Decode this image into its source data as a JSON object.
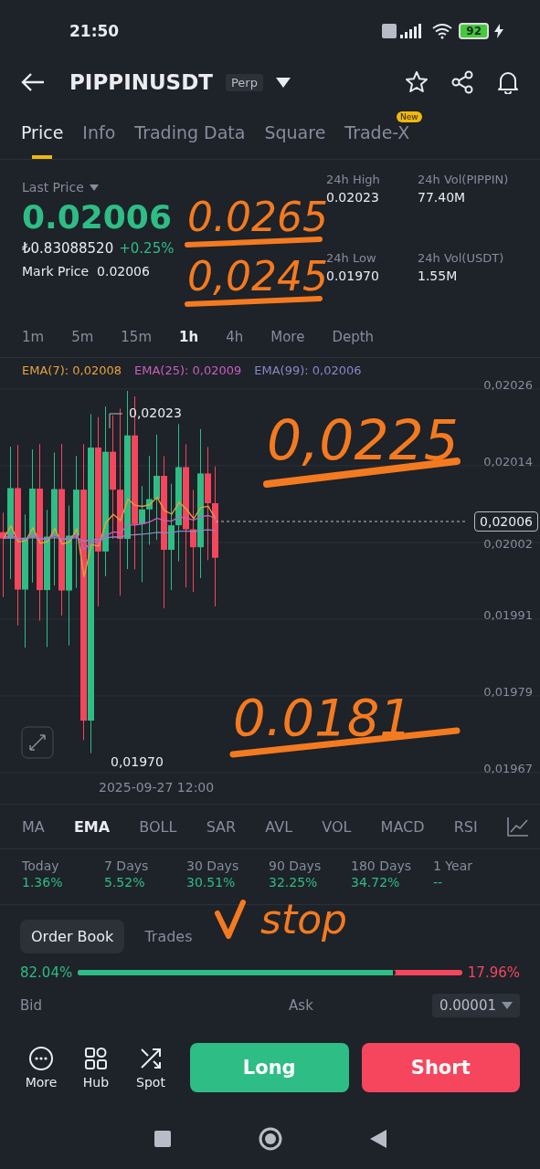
{
  "status_bar": {
    "time": "21:50",
    "battery": "92"
  },
  "header": {
    "symbol": "PIPPINUSDT",
    "badge": "Perp"
  },
  "tabs": [
    {
      "label": "Price",
      "selected": true
    },
    {
      "label": "Info",
      "selected": false
    },
    {
      "label": "Trading Data",
      "selected": false
    },
    {
      "label": "Square",
      "selected": false
    },
    {
      "label": "Trade-X",
      "selected": false,
      "badge": "New"
    }
  ],
  "ticker": {
    "last_price_label": "Last Price",
    "last_price": "0.02006",
    "fiat": "₺0.83088520",
    "change": "+0.25%",
    "mark_label": "Mark Price",
    "mark_price": "0.02006",
    "stats": [
      {
        "label": "24h High",
        "value": "0.02023"
      },
      {
        "label": "24h Vol(PIPPIN)",
        "value": "77.40M"
      },
      {
        "label": "24h Low",
        "value": "0.01970"
      },
      {
        "label": "24h Vol(USDT)",
        "value": "1.55M"
      }
    ]
  },
  "intervals": [
    {
      "label": "1m",
      "selected": false
    },
    {
      "label": "5m",
      "selected": false
    },
    {
      "label": "15m",
      "selected": false
    },
    {
      "label": "1h",
      "selected": true
    },
    {
      "label": "4h",
      "selected": false
    },
    {
      "label": "More",
      "selected": false
    },
    {
      "label": "Depth",
      "selected": false
    }
  ],
  "ema_legend": [
    {
      "text": "EMA(7): 0,02008",
      "color": "#e8a33b"
    },
    {
      "text": "EMA(25): 0,02009",
      "color": "#c95fc0"
    },
    {
      "text": "EMA(99): 0,02006",
      "color": "#8a86c8"
    }
  ],
  "chart": {
    "y_labels": [
      "0,02026",
      "0,02014",
      "0,02002",
      "0,01991",
      "0,01979",
      "0,01967"
    ],
    "high_label": "0,02023",
    "low_label": "0,01970",
    "current": "0,02006",
    "date": "2025-09-27 12:00"
  },
  "indicators": [
    {
      "label": "MA",
      "selected": false
    },
    {
      "label": "EMA",
      "selected": true
    },
    {
      "label": "BOLL",
      "selected": false
    },
    {
      "label": "SAR",
      "selected": false
    },
    {
      "label": "AVL",
      "selected": false
    },
    {
      "label": "VOL",
      "selected": false
    },
    {
      "label": "MACD",
      "selected": false
    },
    {
      "label": "RSI",
      "selected": false
    }
  ],
  "performance": [
    {
      "period": "Today",
      "value": "1.36%"
    },
    {
      "period": "7 Days",
      "value": "5.52%"
    },
    {
      "period": "30 Days",
      "value": "30.51%"
    },
    {
      "period": "90 Days",
      "value": "32.25%"
    },
    {
      "period": "180 Days",
      "value": "34.72%"
    },
    {
      "period": "1 Year",
      "value": "--"
    }
  ],
  "book_tabs": [
    {
      "label": "Order Book",
      "selected": true
    },
    {
      "label": "Trades",
      "selected": false
    }
  ],
  "ratio": {
    "bid": "82.04%",
    "ask": "17.96%",
    "level": 0.8204
  },
  "book_header": {
    "bid": "Bid",
    "ask": "Ask",
    "precision": "0.00001"
  },
  "bottom": {
    "tools": [
      {
        "label": "More",
        "kind": "more"
      },
      {
        "label": "Hub",
        "kind": "hub"
      },
      {
        "label": "Spot",
        "kind": "spot"
      }
    ],
    "long": "Long",
    "short": "Short"
  },
  "annotations": [
    "0.0265",
    "0,0245",
    "0,0225",
    "0.0181",
    "stop"
  ]
}
